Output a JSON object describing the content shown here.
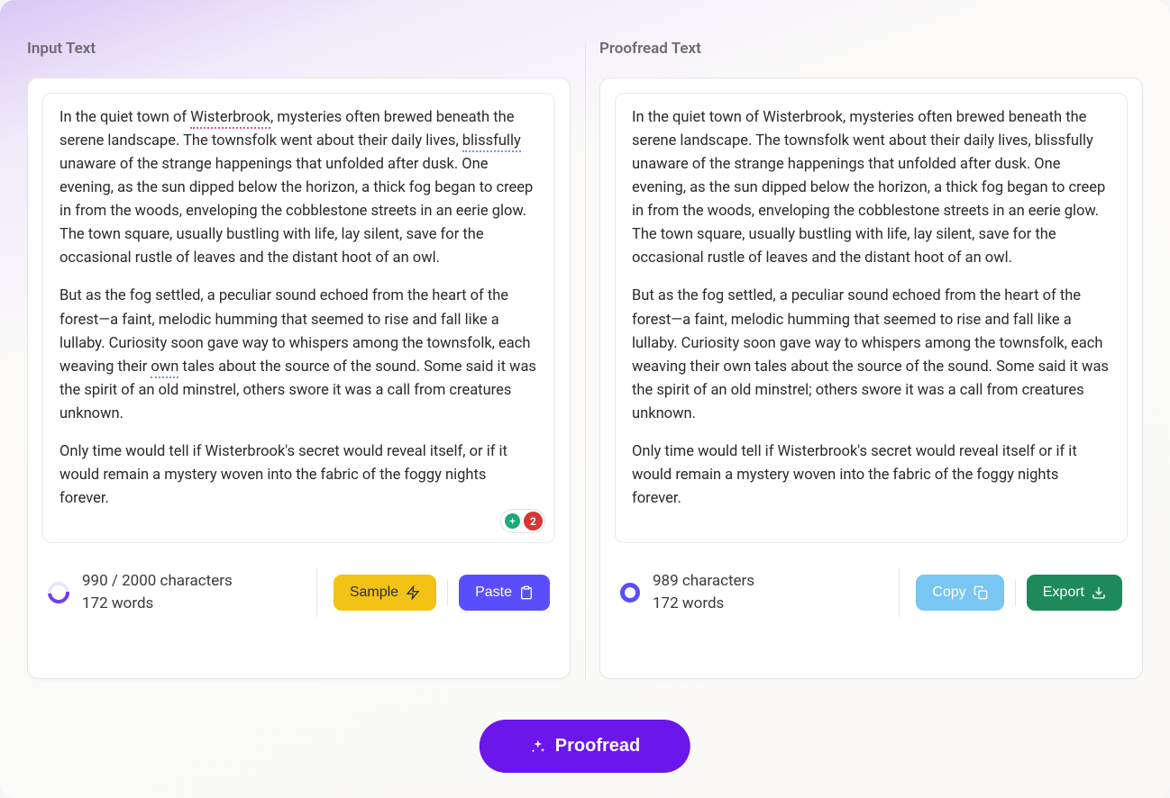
{
  "left": {
    "title": "Input Text",
    "paragraphs": {
      "p1_prefix": "In the quiet town of ",
      "p1_word1": "Wisterbrook",
      "p1_mid1": ", mysteries often brewed beneath the serene landscape. The townsfolk went about their daily lives, ",
      "p1_word2": "blissfully",
      "p1_suffix": " unaware of the strange happenings that unfolded after dusk. One evening, as the sun dipped below the horizon, a thick fog began to creep in from the woods, enveloping the cobblestone streets in an eerie glow. The town square, usually bustling with life, lay silent, save for the occasional rustle of leaves and the distant hoot of an owl.",
      "p2_prefix": "But as the fog settled, a peculiar sound echoed from the heart of the forest—a faint, melodic humming that seemed to rise and fall like a lullaby. Curiosity soon gave way to whispers among the townsfolk, each weaving their ",
      "p2_word1": "own",
      "p2_suffix": " tales about the source of the sound. Some said it was the spirit of an old minstrel, others swore it was a call from creatures unknown.",
      "p3": "Only time would tell if Wisterbrook's secret would reveal itself, or if it would remain a mystery woven into the fabric of the foggy nights forever."
    },
    "badge_count": "2",
    "stats_chars": "990 / 2000 characters",
    "stats_words": "172 words",
    "sample_label": "Sample",
    "paste_label": "Paste"
  },
  "right": {
    "title": "Proofread Text",
    "paragraphs": {
      "p1": "In the quiet town of Wisterbrook, mysteries often brewed beneath the serene landscape. The townsfolk went about their daily lives, blissfully unaware of the strange happenings that unfolded after dusk. One evening, as the sun dipped below the horizon, a thick fog began to creep in from the woods, enveloping the cobblestone streets in an eerie glow. The town square, usually bustling with life, lay silent, save for the occasional rustle of leaves and the distant hoot of an owl.",
      "p2": "But as the fog settled, a peculiar sound echoed from the heart of the forest—a faint, melodic humming that seemed to rise and fall like a lullaby. Curiosity soon gave way to whispers among the townsfolk, each weaving their own tales about the source of the sound. Some said it was the spirit of an old minstrel; others swore it was a call from creatures unknown.",
      "p3": "Only time would tell if Wisterbrook's secret would reveal itself or if it would remain a mystery woven into the fabric of the foggy nights forever."
    },
    "stats_chars": "989 characters",
    "stats_words": "172 words",
    "copy_label": "Copy",
    "export_label": "Export"
  },
  "proofread_label": "Proofread"
}
